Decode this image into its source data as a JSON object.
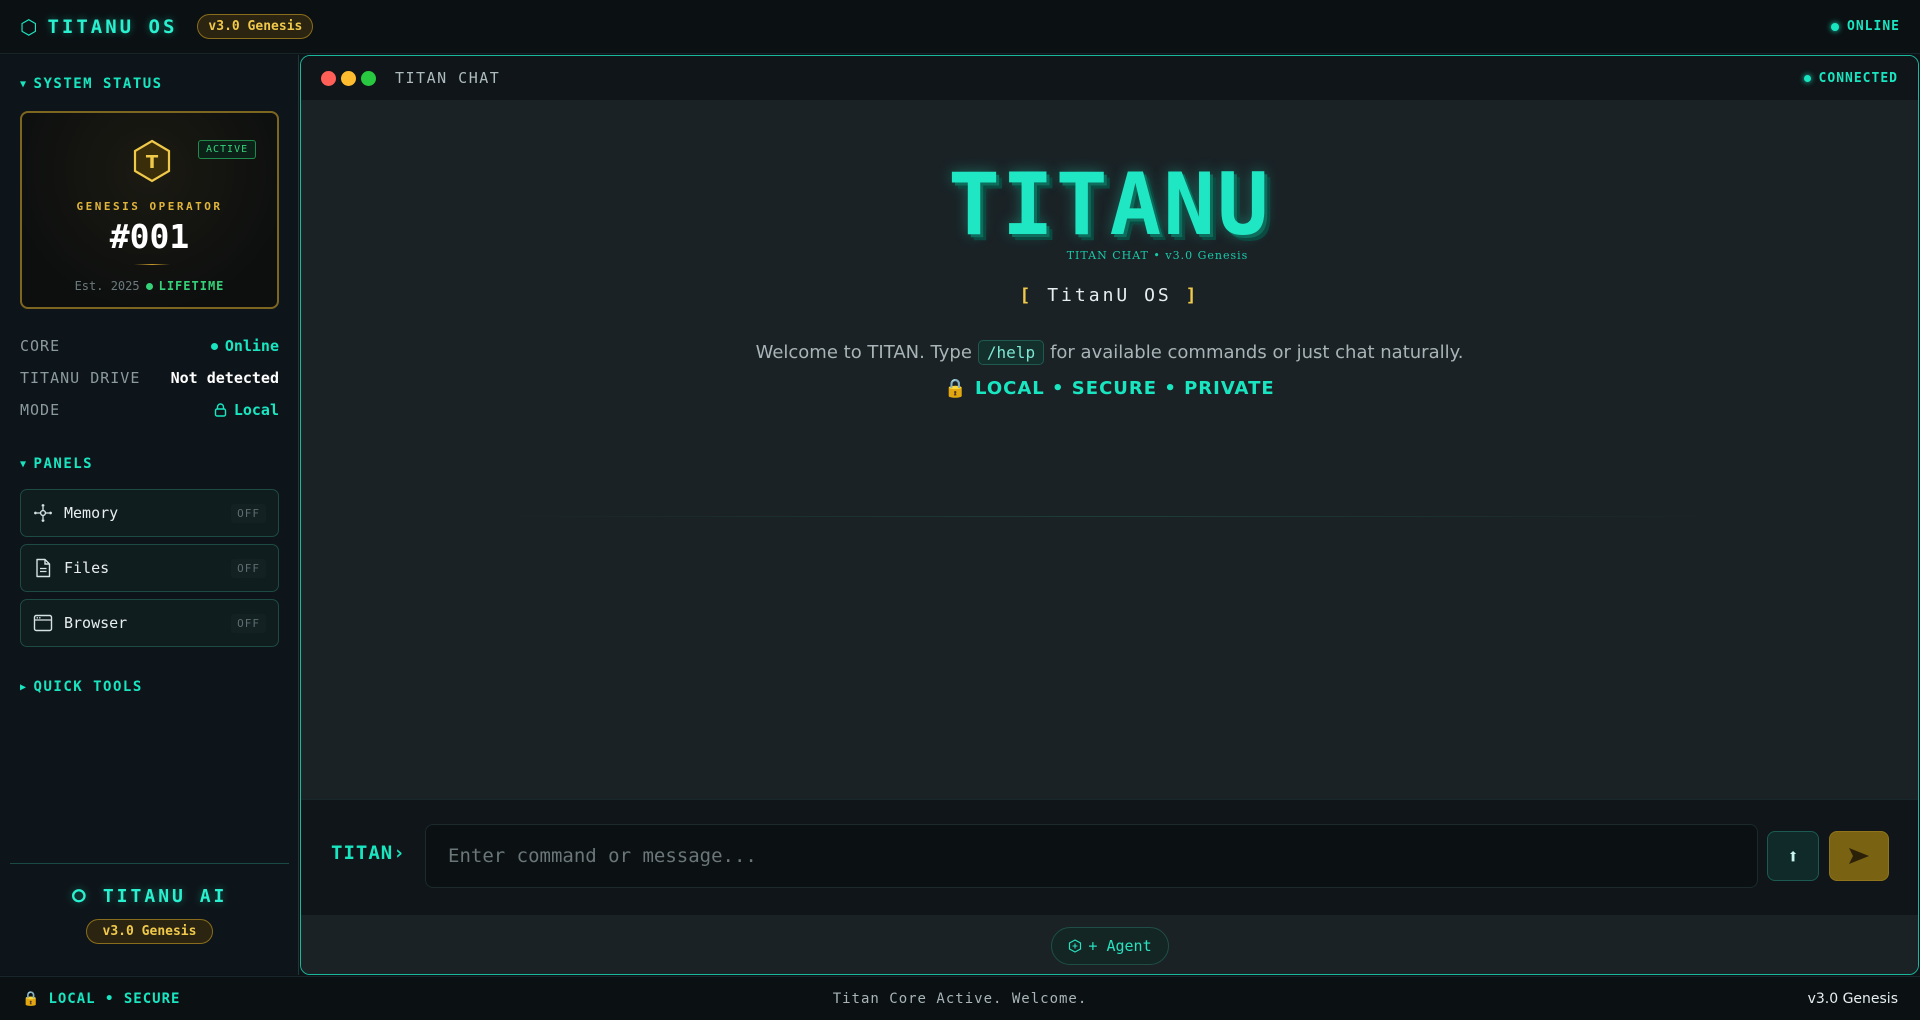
{
  "topbar": {
    "brand": "TITANU OS",
    "version": "v3.0 Genesis",
    "status": "ONLINE"
  },
  "sidebar": {
    "system_status_title": "SYSTEM STATUS",
    "operator": {
      "badge": "ACTIVE",
      "label": "GENESIS OPERATOR",
      "number": "#001",
      "established": "Est. 2025",
      "tier": "LIFETIME",
      "logo_letter": "T"
    },
    "status_rows": [
      {
        "key": "CORE",
        "value": "Online",
        "color": "#19e6c1"
      },
      {
        "key": "TITANU DRIVE",
        "value": "Not detected",
        "color": "#ffffff"
      },
      {
        "key": "MODE",
        "value": "Local",
        "color": "#19e6c1"
      }
    ],
    "panels_title": "PANELS",
    "panels": [
      {
        "label": "Memory",
        "state": "OFF",
        "icon": "network-icon"
      },
      {
        "label": "Files",
        "state": "OFF",
        "icon": "file-icon"
      },
      {
        "label": "Browser",
        "state": "OFF",
        "icon": "browser-window-icon"
      }
    ],
    "quick_tools_title": "QUICK TOOLS",
    "footer": {
      "name": "TITANU AI",
      "version": "v3.0 Genesis"
    }
  },
  "chat": {
    "title": "TITAN CHAT",
    "status": "CONNECTED",
    "logo_text": "TITANU",
    "logo_subtitle": "TITAN CHAT • v3.0 Genesis",
    "os_label": "TitanU OS",
    "welcome_pre": "Welcome to TITAN. Type",
    "welcome_code": "/help",
    "welcome_post": "for available commands or just chat naturally.",
    "tagline": "LOCAL • SECURE • PRIVATE",
    "prompt": "TITAN›",
    "input_value": "",
    "input_placeholder": "Enter command or message...",
    "agent_button": "+ Agent"
  },
  "bottombar": {
    "left": "LOCAL • SECURE",
    "center": "Titan Core Active. Welcome.",
    "right": "v3.0 Genesis"
  },
  "colors": {
    "accent": "#19e6c1",
    "gold": "#f0c94a",
    "traffic_red": "#ff5f57",
    "traffic_yellow": "#febc2e",
    "traffic_green": "#28c840"
  }
}
